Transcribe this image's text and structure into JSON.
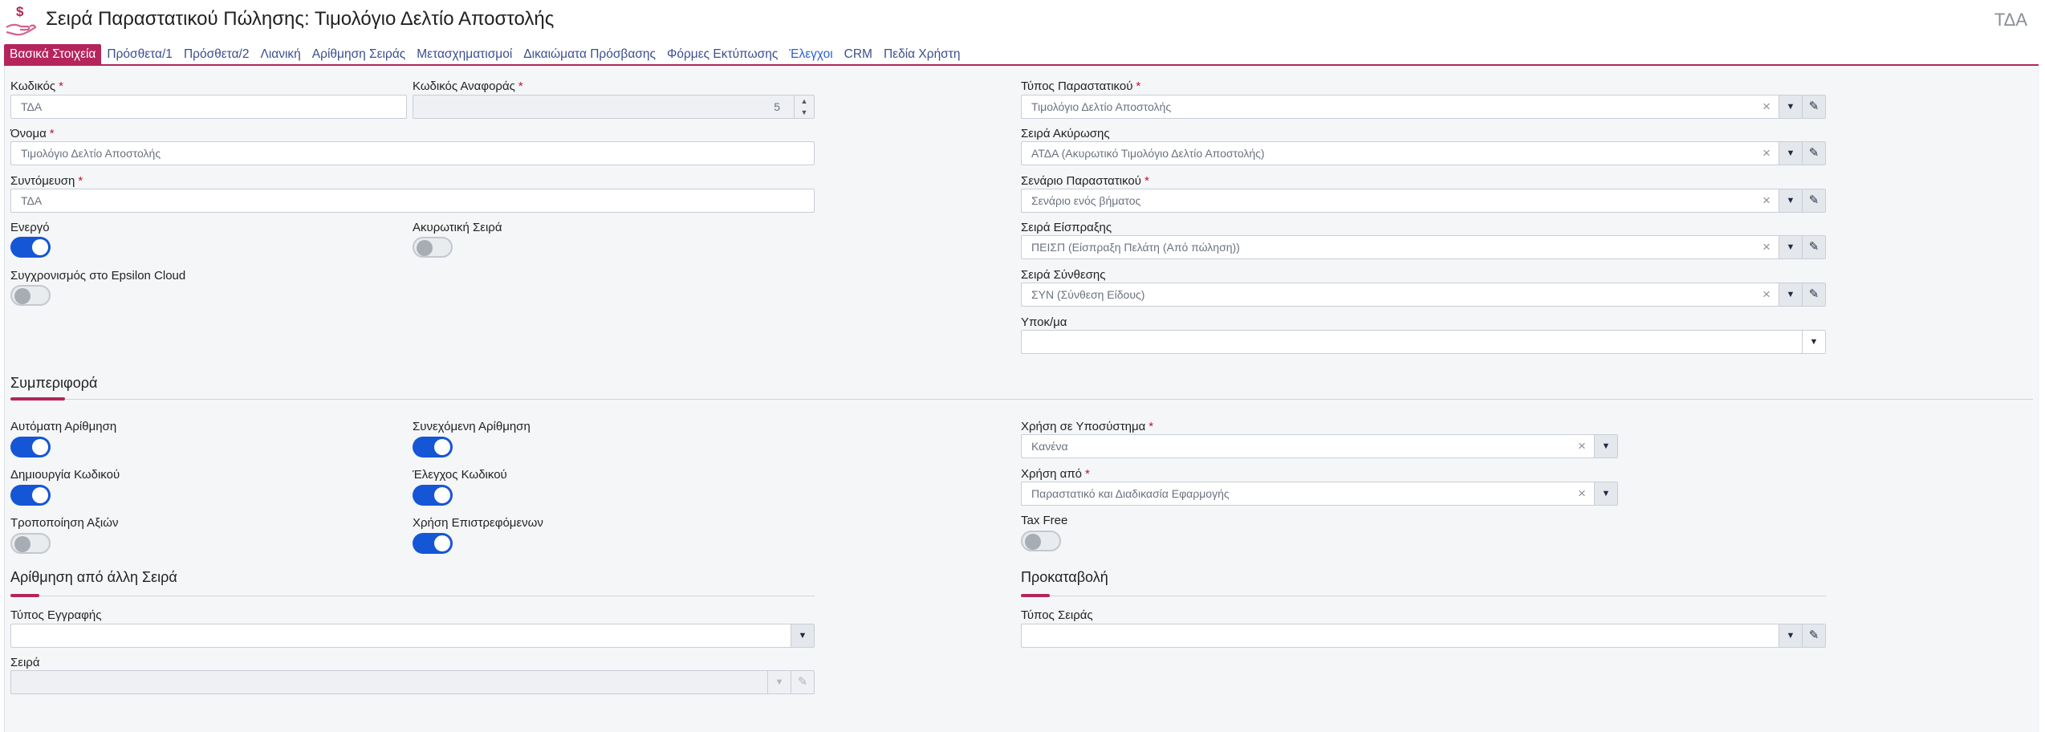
{
  "header": {
    "title": "Σειρά Παραστατικού Πώλησης: Τιμολόγιο Δελτίο Αποστολής",
    "code": "ΤΔΑ"
  },
  "tabs": [
    {
      "label": "Βασικά Στοιχεία"
    },
    {
      "label": "Πρόσθετα/1"
    },
    {
      "label": "Πρόσθετα/2"
    },
    {
      "label": "Λιανική"
    },
    {
      "label": "Αρίθμηση Σειράς"
    },
    {
      "label": "Μετασχηματισμοί"
    },
    {
      "label": "Δικαιώματα Πρόσβασης"
    },
    {
      "label": "Φόρμες Εκτύπωσης"
    },
    {
      "label": "Έλεγχοι"
    },
    {
      "label": "CRM"
    },
    {
      "label": "Πεδία Χρήστη"
    }
  ],
  "basic": {
    "code_label": "Κωδικός",
    "code_value": "ΤΔΑ",
    "ref_code_label": "Κωδικός Αναφοράς",
    "ref_code_value": "5",
    "name_label": "Όνομα",
    "name_value": "Τιμολόγιο Δελτίο Αποστολής",
    "short_label": "Συντόμευση",
    "short_value": "ΤΔΑ",
    "active_label": "Ενεργό",
    "cancel_series_label": "Ακυρωτική Σειρά",
    "sync_label": "Συγχρονισμός στο Epsilon Cloud",
    "doc_type_label": "Τύπος Παραστατικού",
    "doc_type_value": "Τιμολόγιο Δελτίο Αποστολής",
    "cancel_label": "Σειρά Ακύρωσης",
    "cancel_value": "ΑΤΔΑ (Ακυρωτικό Τιμολόγιο Δελτίο Αποστολής)",
    "scenario_label": "Σενάριο Παραστατικού",
    "scenario_value": "Σενάριο ενός βήματος",
    "receipt_label": "Σειρά Είσπραξης",
    "receipt_value": "ΠΕΙΣΠ (Είσπραξη Πελάτη (Από πώληση))",
    "composition_label": "Σειρά Σύνθεσης",
    "composition_value": "ΣΥΝ (Σύνθεση Είδους)",
    "branch_label": "Υποκ/μα",
    "branch_value": ""
  },
  "toggles": {
    "active": true,
    "cancel_series": false,
    "sync": false,
    "auto_numbering": true,
    "continuous_numbering": true,
    "create_code": true,
    "check_code": true,
    "modify_values": false,
    "use_returns": true,
    "tax_free": false
  },
  "behavior": {
    "title": "Συμπεριφορά",
    "auto_numbering_label": "Αυτόματη Αρίθμηση",
    "continuous_numbering_label": "Συνεχόμενη Αρίθμηση",
    "create_code_label": "Δημιουργία Κωδικού",
    "check_code_label": "Έλεγχος Κωδικού",
    "modify_values_label": "Τροποποίηση Αξιών",
    "use_returns_label": "Χρήση Επιστρεφόμενων",
    "subsystem_label": "Χρήση σε Υποσύστημα",
    "subsystem_value": "Κανένα",
    "used_by_label": "Χρήση από",
    "used_by_value": "Παραστατικό και Διαδικασία Εφαρμογής",
    "tax_free_label": "Tax Free"
  },
  "other_numbering": {
    "title": "Αρίθμηση από άλλη Σειρά",
    "record_type_label": "Τύπος Εγγραφής",
    "record_type_value": "",
    "series_label": "Σειρά",
    "series_value": ""
  },
  "prepayment": {
    "title": "Προκαταβολή",
    "series_type_label": "Τύπος Σειράς",
    "series_type_value": ""
  },
  "colors": {
    "accent": "#b5245b",
    "toggle_on": "#1456d6",
    "link": "#3b4f8f"
  }
}
